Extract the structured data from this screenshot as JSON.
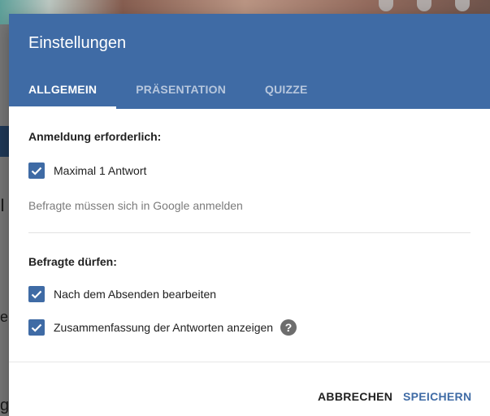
{
  "dialog": {
    "title": "Einstellungen",
    "tabs": [
      {
        "label": "ALLGEMEIN",
        "active": true
      },
      {
        "label": "PRÄSENTATION",
        "active": false
      },
      {
        "label": "QUIZZE",
        "active": false
      }
    ],
    "sign_in_section": {
      "title": "Anmeldung erforderlich:",
      "limit_one_response": {
        "label": "Maximal 1 Antwort",
        "checked": true
      },
      "hint": "Befragte müssen sich in Google anmelden"
    },
    "respondents_section": {
      "title": "Befragte dürfen:",
      "edit_after_submit": {
        "label": "Nach dem Absenden bearbeiten",
        "checked": true
      },
      "see_summary": {
        "label": "Zusammenfassung der Antworten anzeigen",
        "checked": true
      }
    },
    "buttons": {
      "cancel": "ABBRECHEN",
      "save": "SPEICHERN"
    }
  },
  "colors": {
    "header": "#3f6ba5",
    "checkbox": "#3f6ba5",
    "save_button": "#3f6ba5",
    "overlay": "#7a7a7a"
  }
}
